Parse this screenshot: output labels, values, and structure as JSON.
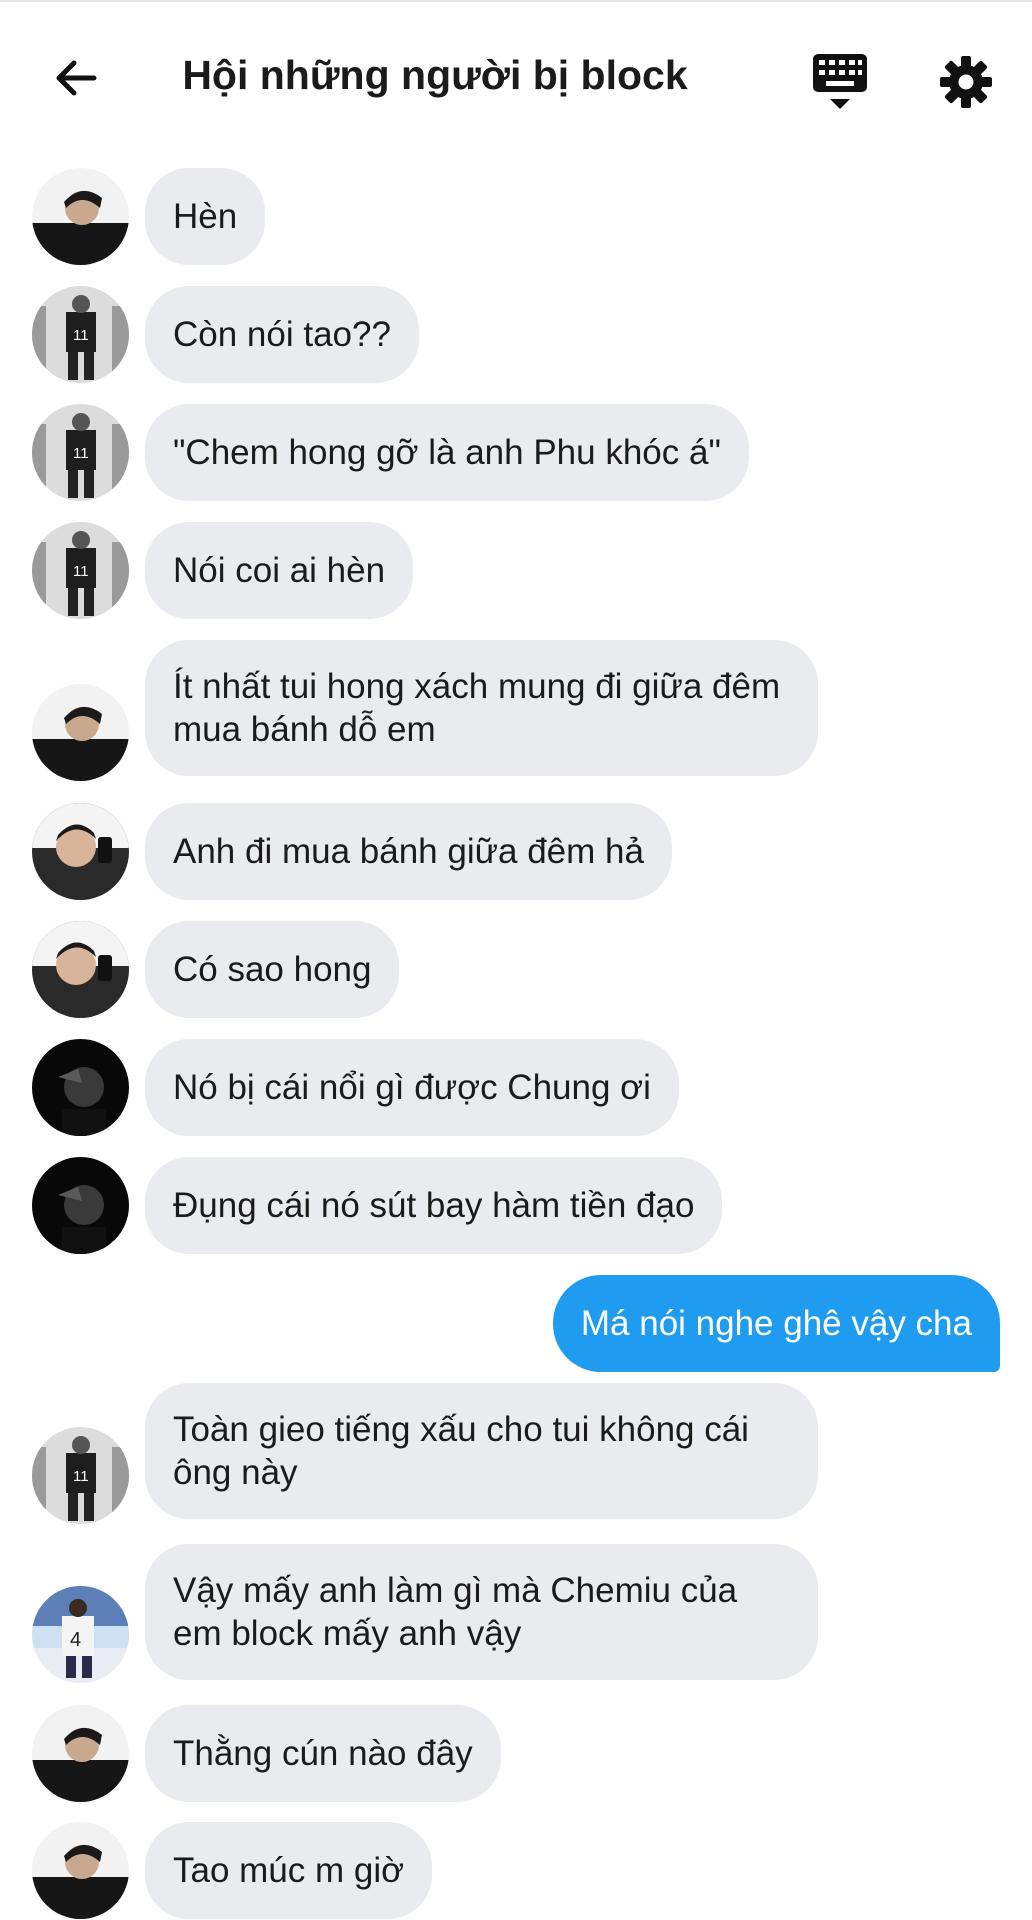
{
  "header": {
    "title": "Hội những người bị block",
    "back_icon": "arrow-left-icon",
    "keyboard_icon": "keyboard-icon",
    "settings_icon": "gear-icon"
  },
  "colors": {
    "bubble_received": "#e9ebee",
    "bubble_sent": "#1f9cf0",
    "text": "#1b1b1b"
  },
  "messages": [
    {
      "sender": "avatar-a",
      "text": "Hèn",
      "mine": false
    },
    {
      "sender": "avatar-b",
      "text": "Còn nói tao??",
      "mine": false
    },
    {
      "sender": "avatar-b",
      "text": "\"Chem hong gỡ là anh Phu khóc á\"",
      "mine": false
    },
    {
      "sender": "avatar-b",
      "text": "Nói coi ai hèn",
      "mine": false
    },
    {
      "sender": "avatar-a",
      "text": "Ít nhất tui hong xách mung đi giữa đêm mua bánh dỗ em",
      "mine": false
    },
    {
      "sender": "avatar-c",
      "text": "Anh đi mua bánh giữa đêm hả",
      "mine": false
    },
    {
      "sender": "avatar-c",
      "text": "Có sao hong",
      "mine": false
    },
    {
      "sender": "avatar-d",
      "text": "Nó bị cái nổi gì được Chung ơi",
      "mine": false
    },
    {
      "sender": "avatar-d",
      "text": "Đụng cái nó sút bay hàm tiền đạo",
      "mine": false
    },
    {
      "sender": "me",
      "text": "Má nói nghe ghê vậy cha",
      "mine": true
    },
    {
      "sender": "avatar-b",
      "text": "Toàn gieo tiếng xấu cho tui không cái ông này",
      "mine": false
    },
    {
      "sender": "avatar-e",
      "text": "Vậy mấy anh làm gì mà Chemiu của em block mấy anh vậy",
      "mine": false
    },
    {
      "sender": "avatar-a",
      "text": "Thằng cún nào đây",
      "mine": false
    },
    {
      "sender": "avatar-a",
      "text": "Tao múc m giờ",
      "mine": false
    }
  ]
}
